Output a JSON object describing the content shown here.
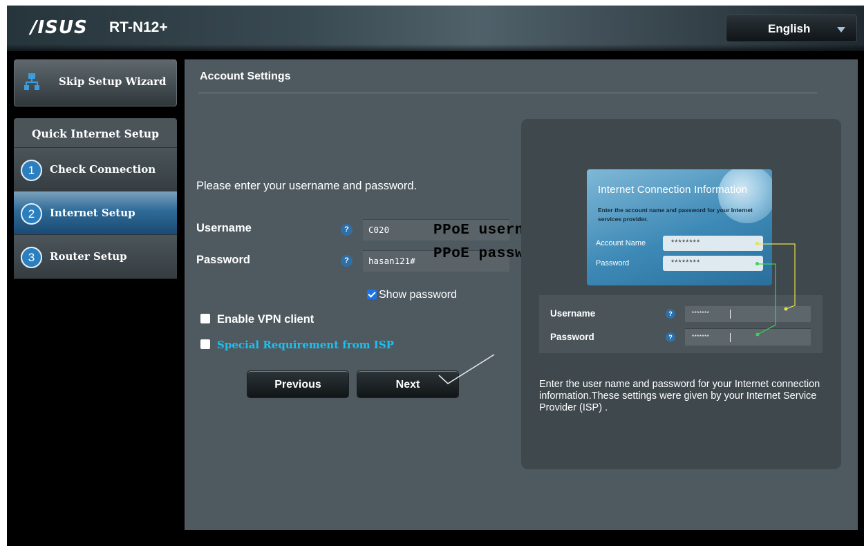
{
  "header": {
    "logo": "/ISUS",
    "model": "RT-N12+",
    "language": "English"
  },
  "sidebar": {
    "skip_button": "Skip Setup Wizard",
    "section_title": "Quick Internet Setup",
    "steps": [
      {
        "num": "1",
        "label": "Check Connection",
        "active": false
      },
      {
        "num": "2",
        "label": "Internet Setup",
        "active": true
      },
      {
        "num": "3",
        "label": "Router Setup",
        "active": false
      }
    ]
  },
  "main": {
    "title": "Account Settings",
    "prompt": "Please enter your username and password.",
    "username_label": "Username",
    "username_value": "C020",
    "password_label": "Password",
    "password_value": "hasan121#",
    "help_glyph": "?",
    "show_password_label": "Show password",
    "show_password_checked": true,
    "vpn_label": "Enable VPN client",
    "vpn_checked": false,
    "isp_label": "Special Requirement from ISP",
    "isp_checked": false,
    "previous_button": "Previous",
    "next_button": "Next",
    "overlay_username": "PPoE username",
    "overlay_password": "PPoE password"
  },
  "help_panel": {
    "card_title": "Internet Connection Information",
    "card_desc": "Enter the account name and password for your Internet services provider.",
    "card_account_label": "Account Name",
    "card_account_value": "********",
    "card_password_label": "Password",
    "card_password_value": "********",
    "mini_username_label": "Username",
    "mini_username_value": "*******",
    "mini_password_label": "Password",
    "mini_password_value": "*******",
    "help_glyph": "?",
    "description": "Enter the user name and password for your Internet connection information.These settings were given by your Internet Service Provider (ISP) ."
  },
  "colors": {
    "accent_blue": "#2c7fbf",
    "link_cyan": "#1ec0f0",
    "panel_gray": "#4f5a60",
    "connector_yellow": "#e8e24a",
    "connector_green": "#3fd25a"
  }
}
